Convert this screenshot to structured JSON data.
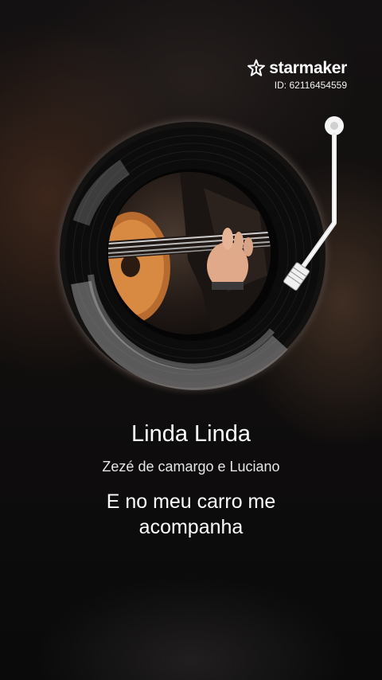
{
  "brand": {
    "name": "starmaker",
    "user_id": "ID: 62116454559",
    "icon": "star-person-icon"
  },
  "song": {
    "title": "Linda Linda",
    "artist": "Zezé de camargo e Luciano"
  },
  "lyrics": {
    "line1": "E no meu carro me",
    "line2": "acompanha"
  },
  "colors": {
    "background": "#0b0a0a",
    "text": "#ffffff",
    "record": "#0d0d0d",
    "tonearm": "#f2f2f2"
  }
}
